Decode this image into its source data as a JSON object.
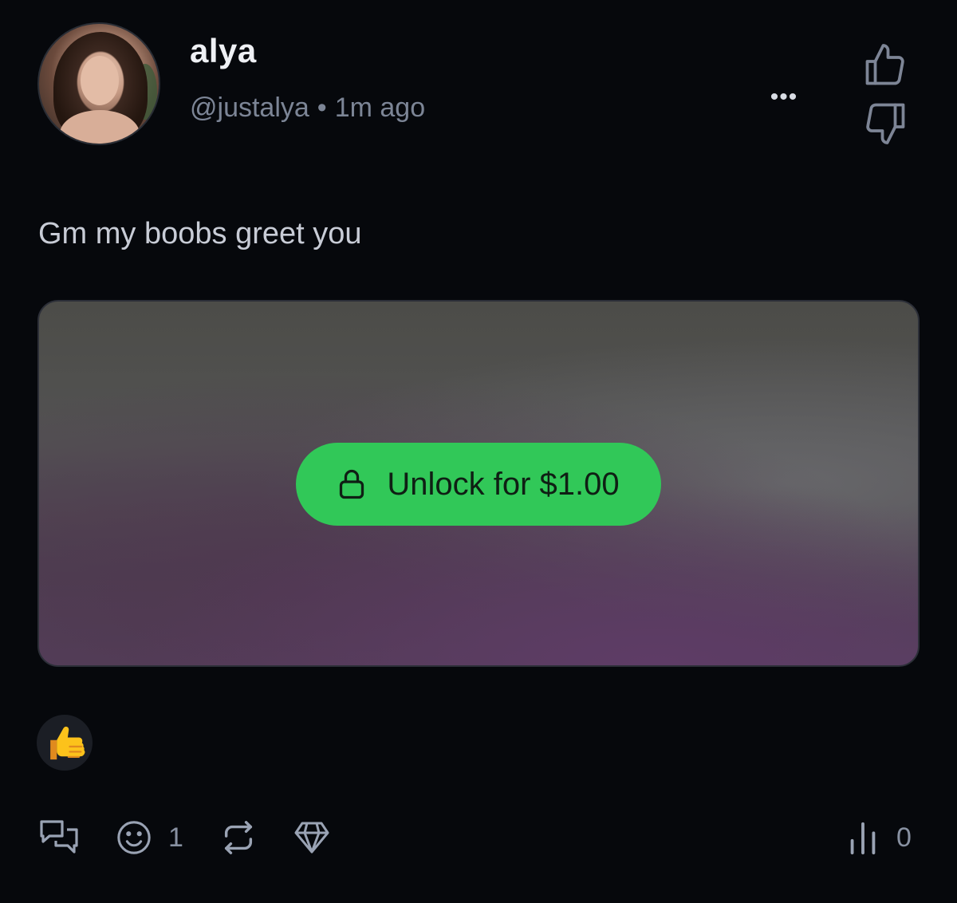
{
  "post": {
    "author_name": "alya",
    "handle": "@justalya",
    "separator": "•",
    "time": "1m ago",
    "text": "Gm my boobs greet you",
    "more_label": "•••"
  },
  "media": {
    "unlock_label": "Unlock for $1.00",
    "icon": "lock-icon"
  },
  "reactions": [
    {
      "icon": "thumbs-up-emoji"
    }
  ],
  "actions": {
    "reaction_count": "1",
    "views_count": "0"
  },
  "colors": {
    "background": "#06080c",
    "accent": "#31c858"
  }
}
